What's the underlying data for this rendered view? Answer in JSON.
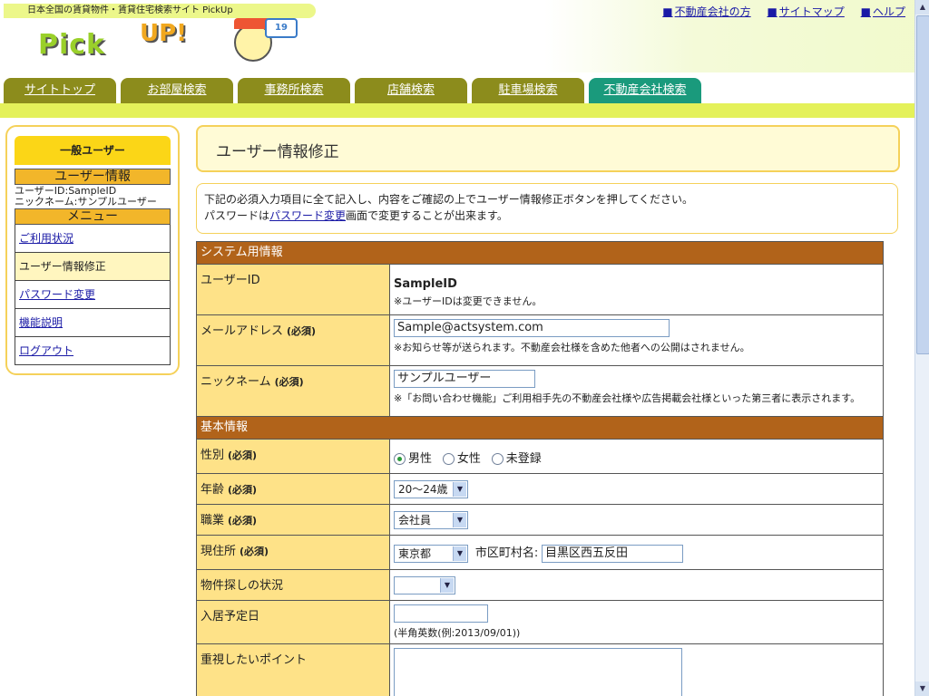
{
  "header": {
    "tagline": "日本全国の賃貸物件・賃貸住宅検索サイト PickUp",
    "logo_text": "Pick",
    "logo_up": "UP!",
    "flag_badge": "19",
    "top_links": [
      "不動産会社の方",
      "サイトマップ",
      "ヘルプ"
    ]
  },
  "tabs": [
    "サイトトップ",
    "お部屋検索",
    "事務所検索",
    "店舗検索",
    "駐車場検索",
    "不動産会社検索"
  ],
  "sidebar": {
    "user_type": "一般ユーザー",
    "user_info_header": "ユーザー情報",
    "user_id_line": "ユーザーID:SampleID",
    "nickname_line": "ニックネーム:サンプルユーザー",
    "menu_header": "メニュー",
    "menu_items": [
      "ご利用状況",
      "ユーザー情報修正",
      "パスワード変更",
      "機能説明",
      "ログアウト"
    ]
  },
  "main": {
    "title": "ユーザー情報修正",
    "notice_line1": "下記の必須入力項目に全て記入し、内容をご確認の上でユーザー情報修正ボタンを押してください。",
    "notice_line2_pre": "パスワードは",
    "notice_line2_link": "パスワード変更",
    "notice_line2_post": "画面で変更することが出来ます。"
  },
  "form": {
    "section_system": "システム用情報",
    "section_basic": "基本情報",
    "required_mark": "(必須)",
    "user_id_label": "ユーザーID",
    "user_id_value": "SampleID",
    "user_id_note": "※ユーザーIDは変更できません。",
    "email_label": "メールアドレス",
    "email_value": "Sample@actsystem.com",
    "email_note": "※お知らせ等が送られます。不動産会社様を含めた他者への公開はされません。",
    "nickname_label": "ニックネーム",
    "nickname_value": "サンプルユーザー",
    "nickname_note": "※「お問い合わせ機能」ご利用相手先の不動産会社様や広告掲載会社様といった第三者に表示されます。",
    "gender_label": "性別",
    "gender_options": [
      "男性",
      "女性",
      "未登録"
    ],
    "gender_selected": "男性",
    "age_label": "年齢",
    "age_value": "20～24歳",
    "job_label": "職業",
    "job_value": "会社員",
    "address_label": "現住所",
    "pref_value": "東京都",
    "city_label": "市区町村名:",
    "city_value": "目黒区西五反田",
    "search_status_label": "物件探しの状況",
    "search_status_value": "",
    "move_date_label": "入居予定日",
    "move_date_value": "",
    "move_date_note": "(半角英数(例:2013/09/01))",
    "priority_label": "重視したいポイント",
    "priority_value": ""
  },
  "colors": {
    "tab_bg": "#8c8c1c",
    "tab_active_bg": "#1a9a7c",
    "section_bg": "#b1631a",
    "label_bg": "#fee288",
    "accent_yellow": "#fbd617"
  }
}
